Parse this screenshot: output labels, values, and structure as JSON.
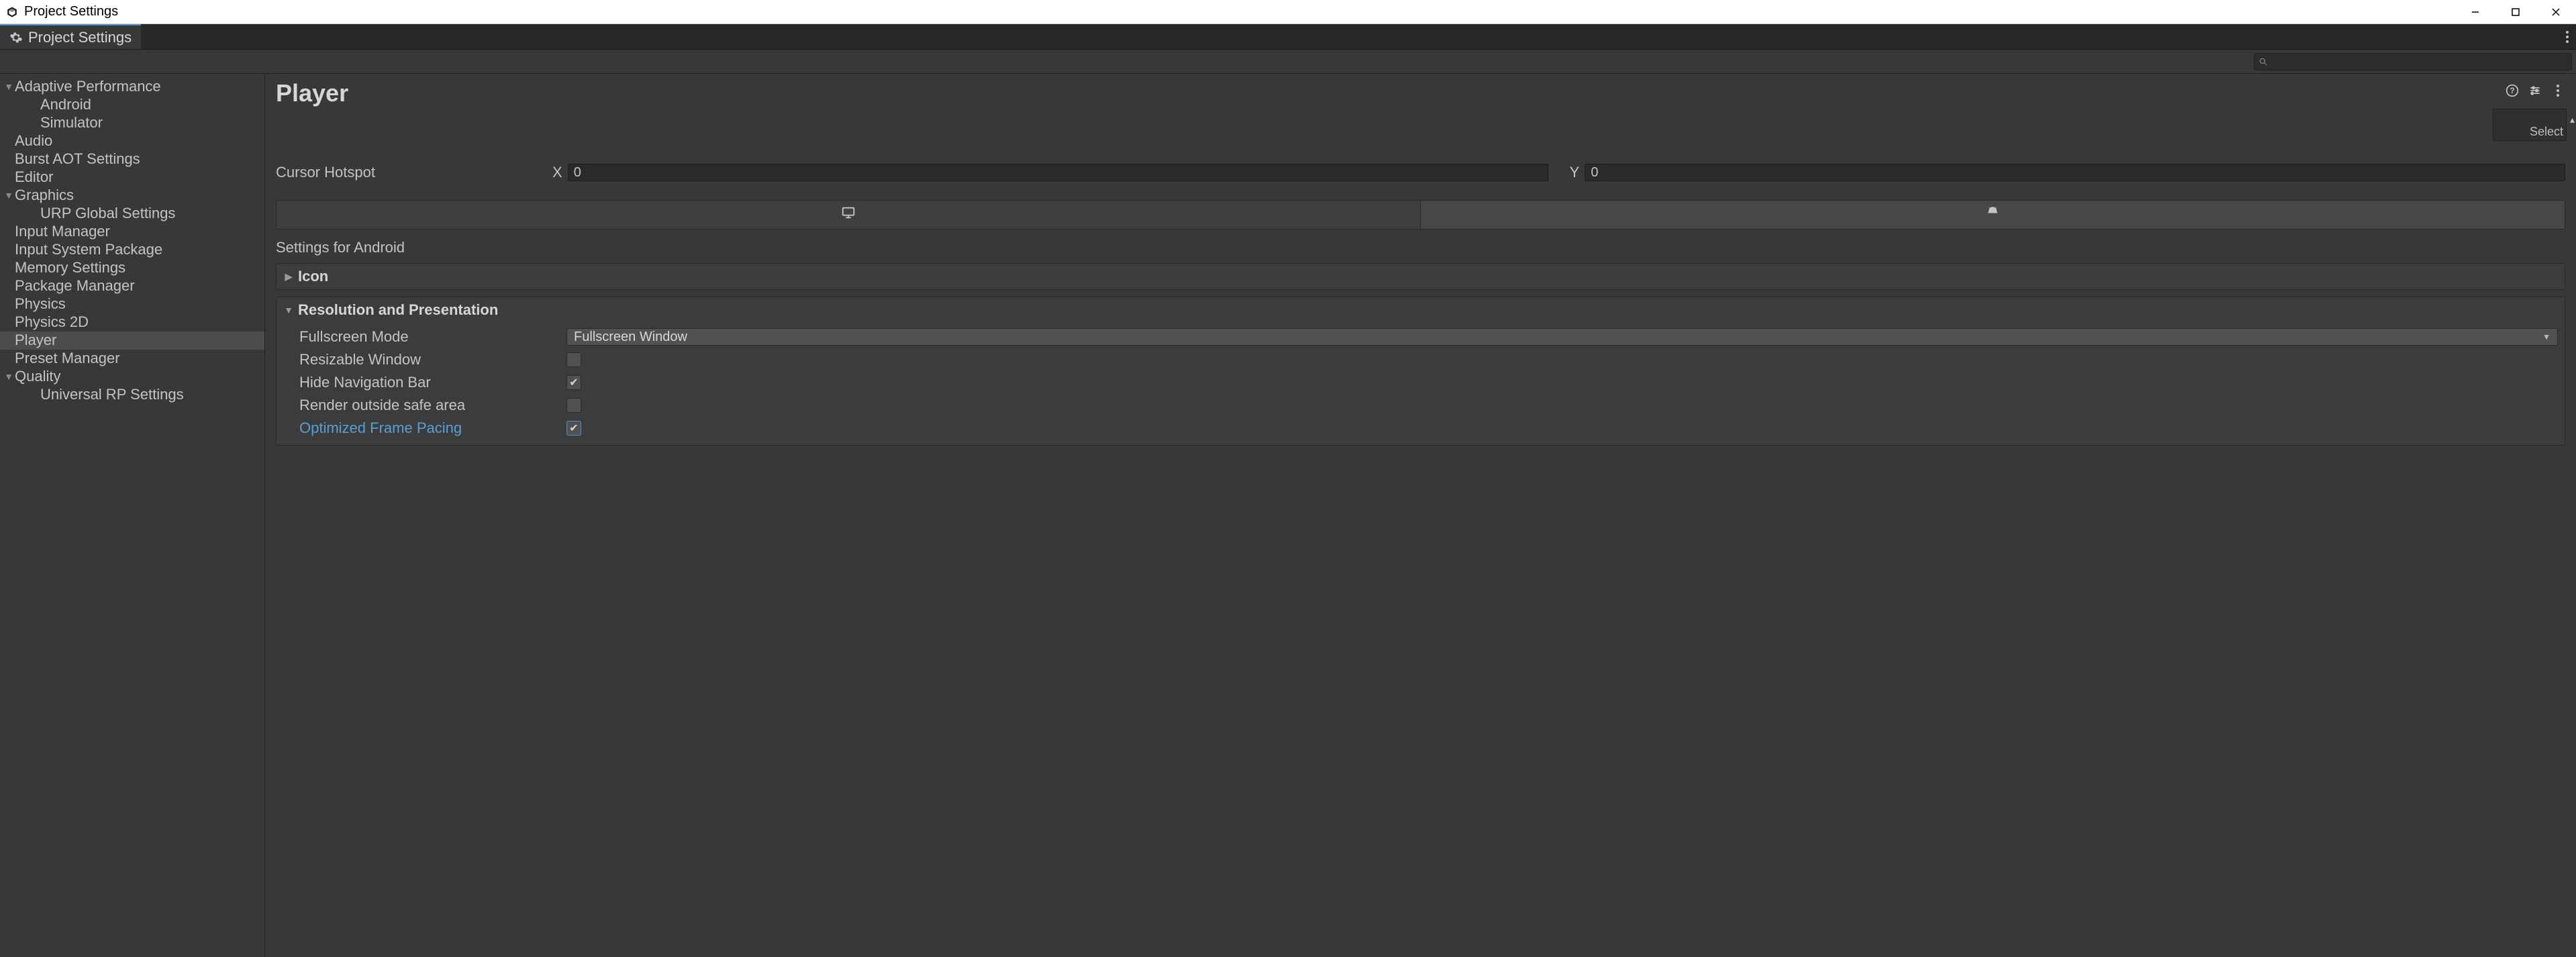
{
  "window": {
    "title": "Project Settings"
  },
  "tab": {
    "label": "Project Settings"
  },
  "search": {
    "placeholder": ""
  },
  "sidebar": {
    "items": [
      {
        "label": "Adaptive Performance",
        "indent": 0,
        "fold": "open"
      },
      {
        "label": "Android",
        "indent": 1,
        "fold": "none"
      },
      {
        "label": "Simulator",
        "indent": 1,
        "fold": "none"
      },
      {
        "label": "Audio",
        "indent": 0,
        "fold": "none"
      },
      {
        "label": "Burst AOT Settings",
        "indent": 0,
        "fold": "none"
      },
      {
        "label": "Editor",
        "indent": 0,
        "fold": "none"
      },
      {
        "label": "Graphics",
        "indent": 0,
        "fold": "open"
      },
      {
        "label": "URP Global Settings",
        "indent": 1,
        "fold": "none"
      },
      {
        "label": "Input Manager",
        "indent": 0,
        "fold": "none"
      },
      {
        "label": "Input System Package",
        "indent": 0,
        "fold": "none"
      },
      {
        "label": "Memory Settings",
        "indent": 0,
        "fold": "none"
      },
      {
        "label": "Package Manager",
        "indent": 0,
        "fold": "none"
      },
      {
        "label": "Physics",
        "indent": 0,
        "fold": "none"
      },
      {
        "label": "Physics 2D",
        "indent": 0,
        "fold": "none"
      },
      {
        "label": "Player",
        "indent": 0,
        "fold": "none",
        "selected": true
      },
      {
        "label": "Preset Manager",
        "indent": 0,
        "fold": "none"
      },
      {
        "label": "Quality",
        "indent": 0,
        "fold": "open"
      },
      {
        "label": "Universal RP Settings",
        "indent": 1,
        "fold": "none"
      }
    ]
  },
  "page": {
    "title": "Player",
    "select_label": "Select",
    "cursor_hotspot_label": "Cursor Hotspot",
    "x_label": "X",
    "y_label": "Y",
    "x_value": "0",
    "y_value": "0",
    "settings_for": "Settings for Android",
    "section_icon": "Icon",
    "section_res": "Resolution and Presentation",
    "fullscreen_mode_label": "Fullscreen Mode",
    "fullscreen_mode_value": "Fullscreen Window",
    "resizable_label": "Resizable Window",
    "hide_nav_label": "Hide Navigation Bar",
    "render_safe_label": "Render outside safe area",
    "optimized_fp_label": "Optimized Frame Pacing",
    "resizable_checked": false,
    "hide_nav_checked": true,
    "render_safe_checked": false,
    "optimized_fp_checked": true
  }
}
